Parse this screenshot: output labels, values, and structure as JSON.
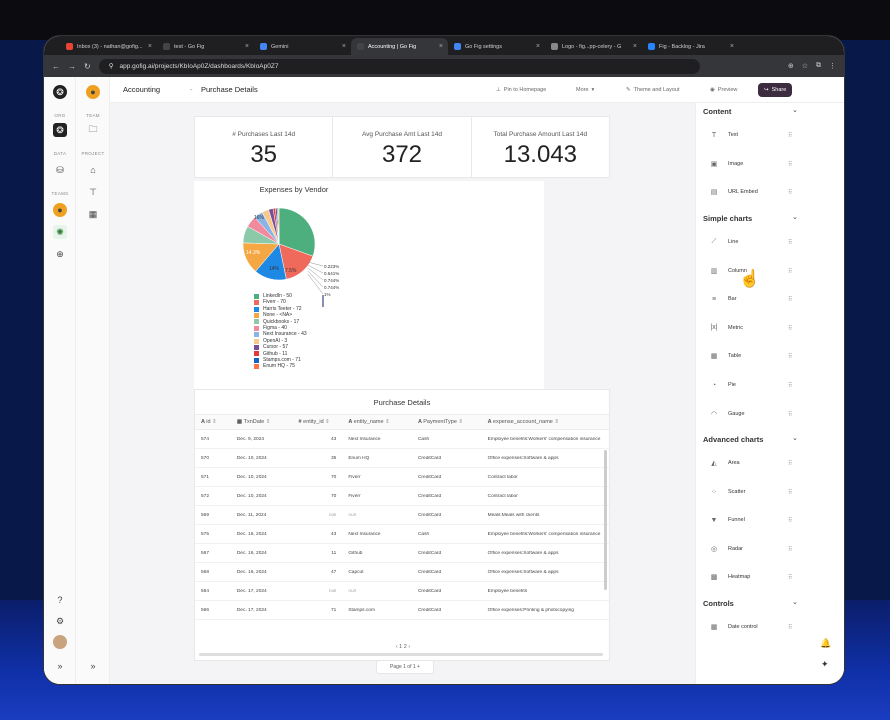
{
  "browser": {
    "tabs": [
      {
        "label": "Inbox (3) - nathan@gofig..."
      },
      {
        "label": "test - Go Fig"
      },
      {
        "label": "Gemini"
      },
      {
        "label": "Accounting | Go Fig"
      },
      {
        "label": "Go Fig settings"
      },
      {
        "label": "Logo - fig...pp-celery - G"
      },
      {
        "label": "Fig - Backlog - Jira"
      }
    ],
    "url": "app.gofig.ai/projects/KbIoAp0Z/dashboards/KbIoAp0Z7"
  },
  "rail": {
    "org_label": "ORG",
    "data_label": "DATA",
    "teams_label": "TEAMS",
    "team_label": "TEAM",
    "project_label": "PROJECT"
  },
  "topbar": {
    "project": "Accounting",
    "dashboard": "Purchase Details",
    "pin": "Pin to Homepage",
    "more": "More",
    "theme": "Theme and Layout",
    "preview": "Preview",
    "share": "Share"
  },
  "kpis": [
    {
      "label": "# Purchases Last 14d",
      "value": "35"
    },
    {
      "label": "Avg Purchase Amt Last 14d",
      "value": "372"
    },
    {
      "label": "Total Purchase Amount Last 14d",
      "value": "13.043"
    }
  ],
  "chart_data": {
    "type": "pie",
    "title": "Expenses by Vendor",
    "labels": [
      "LinkedIn",
      "Fiverr",
      "Harris Teeter",
      "None - <NA>",
      "Quickbooks",
      "Figma",
      "Next Insurance",
      "OpenAI",
      "Cursor",
      "Github",
      "Stamps.com",
      "Enum HQ"
    ],
    "legend": [
      "LinkedIn - 50",
      "Fiverr - 70",
      "Harris Teeter - 72",
      "None - <NA>",
      "Quickbooks - 17",
      "Figma - 40",
      "Next Insurance - 43",
      "OpenAI - 3",
      "Cursor - 57",
      "Github - 11",
      "Stamps.com - 71",
      "Enum HQ - 75"
    ],
    "slice_labels": [
      "16%",
      "14.3%",
      "14%",
      "7.5%",
      "0.223%",
      "0.641%",
      "0.744%",
      "0.744%",
      "1%"
    ],
    "values": [
      30,
      16,
      14.3,
      14,
      7.5,
      5,
      4,
      3,
      2,
      1,
      0.744,
      0.641,
      0.223
    ],
    "colors": [
      "#4caf7d",
      "#f06a5b",
      "#1e88e5",
      "#f4a742",
      "#8bc9a8",
      "#f08a9c",
      "#8ab4e8",
      "#f7c98a",
      "#7a4f9a",
      "#e53935",
      "#1565c0",
      "#ff7043"
    ]
  },
  "table": {
    "title": "Purchase Details",
    "columns": [
      "id",
      "TxnDate",
      "entity_id",
      "entity_name",
      "PaymentType",
      "expense_account_name"
    ],
    "rows": [
      [
        "574",
        "Dec. 9, 2024",
        "43",
        "Next Insurance",
        "Cash",
        "Employee benefits:Workers' compensation insurance"
      ],
      [
        "570",
        "Dec. 10, 2024",
        "35",
        "Enum HQ",
        "CreditCard",
        "Office expenses:Software & apps"
      ],
      [
        "571",
        "Dec. 10, 2024",
        "70",
        "Fiverr",
        "CreditCard",
        "Contract labor"
      ],
      [
        "572",
        "Dec. 10, 2024",
        "70",
        "Fiverr",
        "CreditCard",
        "Contract labor"
      ],
      [
        "569",
        "Dec. 11, 2024",
        "null",
        "null",
        "CreditCard",
        "Meals:Meals with clients"
      ],
      [
        "575",
        "Dec. 16, 2024",
        "43",
        "Next Insurance",
        "Cash",
        "Employee benefits:Workers' compensation insurance"
      ],
      [
        "567",
        "Dec. 16, 2024",
        "11",
        "Github",
        "CreditCard",
        "Office expenses:Software & apps"
      ],
      [
        "568",
        "Dec. 16, 2024",
        "47",
        "Capcut",
        "CreditCard",
        "Office expenses:Software & apps"
      ],
      [
        "564",
        "Dec. 17, 2024",
        "null",
        "null",
        "CreditCard",
        "Employee benefits"
      ],
      [
        "566",
        "Dec. 17, 2024",
        "71",
        "Stamps.com",
        "CreditCard",
        "Office expenses:Printing & photocopying"
      ]
    ],
    "pager": "‹  1  2  ›"
  },
  "page_bar": {
    "text": "Page  1  of 1  +"
  },
  "sidebar": {
    "content_title": "Content",
    "content_items": [
      "Text",
      "Image",
      "URL Embed"
    ],
    "simple_title": "Simple charts",
    "simple_items": [
      "Line",
      "Column",
      "Bar",
      "Metric",
      "Table",
      "Pie",
      "Gauge"
    ],
    "advanced_title": "Advanced charts",
    "advanced_items": [
      "Area",
      "Scatter",
      "Funnel",
      "Radar",
      "Heatmap"
    ],
    "controls_title": "Controls",
    "controls_items": [
      "Date control"
    ]
  }
}
